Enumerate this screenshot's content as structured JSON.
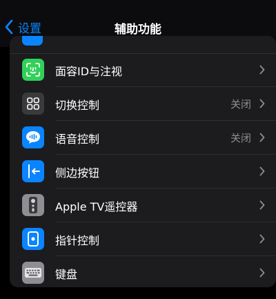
{
  "nav": {
    "back_label": "设置",
    "title": "辅助功能",
    "back_icon": "chevron-left-icon"
  },
  "items": [
    {
      "label": "面容ID与注视",
      "value": "",
      "icon": "face-id-icon",
      "color": "#30d158"
    },
    {
      "label": "切换控制",
      "value": "关闭",
      "icon": "switch-control-icon",
      "color": "#3a3a3c"
    },
    {
      "label": "语音控制",
      "value": "关闭",
      "icon": "voice-control-icon",
      "color": "#0a84ff"
    },
    {
      "label": "侧边按钮",
      "value": "",
      "icon": "side-button-icon",
      "color": "#0a84ff"
    },
    {
      "label": "Apple TV遥控器",
      "value": "",
      "icon": "tv-remote-icon",
      "color": "#8e8e93"
    },
    {
      "label": "指针控制",
      "value": "",
      "icon": "pointer-control-icon",
      "color": "#0a84ff"
    },
    {
      "label": "键盘",
      "value": "",
      "icon": "keyboard-icon",
      "color": "#8e8e93"
    }
  ],
  "colors": {
    "accent": "#0a84ff",
    "row_background": "#1c1c1e",
    "secondary_text": "#8e8e93"
  }
}
